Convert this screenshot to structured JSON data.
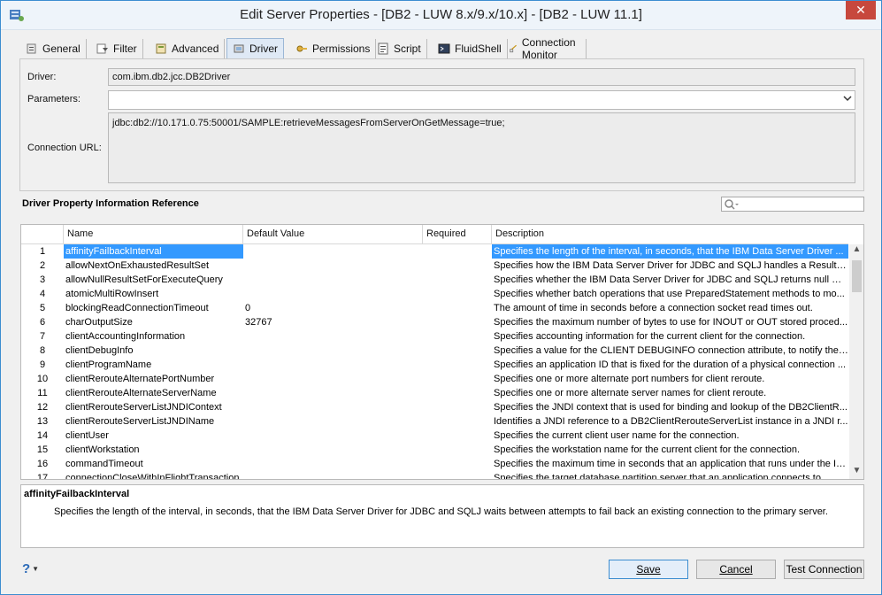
{
  "window": {
    "title": "Edit Server Properties - [DB2 - LUW 8.x/9.x/10.x] - [DB2 - LUW 11.1]",
    "close_label": "✕"
  },
  "tabs": [
    {
      "label": "General",
      "icon": "general-icon"
    },
    {
      "label": "Filter",
      "icon": "filter-icon"
    },
    {
      "label": "Advanced",
      "icon": "advanced-icon"
    },
    {
      "label": "Driver",
      "icon": "driver-icon",
      "active": true
    },
    {
      "label": "Permissions",
      "icon": "permissions-icon"
    },
    {
      "label": "Script",
      "icon": "script-icon"
    },
    {
      "label": "FluidShell",
      "icon": "fluidshell-icon"
    },
    {
      "label": "Connection Monitor",
      "icon": "connection-monitor-icon"
    }
  ],
  "driver_panel": {
    "driver_label": "Driver:",
    "driver_value": "com.ibm.db2.jcc.DB2Driver",
    "parameters_label": "Parameters:",
    "parameters_value": "",
    "url_label": "Connection URL:",
    "url_value": "jdbc:db2://10.171.0.75:50001/SAMPLE:retrieveMessagesFromServerOnGetMessage=true;"
  },
  "reference": {
    "title": "Driver Property Information Reference",
    "search_placeholder": ""
  },
  "table": {
    "columns": [
      "Name",
      "Default Value",
      "Required",
      "Description"
    ],
    "rows": [
      {
        "num": "1",
        "name": "affinityFailbackInterval",
        "default": "",
        "required": "",
        "desc": "Specifies the length of the interval, in seconds, that the IBM Data Server Driver ..."
      },
      {
        "num": "2",
        "name": "allowNextOnExhaustedResultSet",
        "default": "",
        "required": "",
        "desc": "Specifies how the IBM Data Server Driver for JDBC and SQLJ handles a ResultSe..."
      },
      {
        "num": "3",
        "name": "allowNullResultSetForExecuteQuery",
        "default": "",
        "required": "",
        "desc": "Specifies whether the IBM Data Server Driver for JDBC and SQLJ returns null wh..."
      },
      {
        "num": "4",
        "name": "atomicMultiRowInsert",
        "default": "",
        "required": "",
        "desc": "Specifies whether batch operations that use PreparedStatement methods to mo..."
      },
      {
        "num": "5",
        "name": "blockingReadConnectionTimeout",
        "default": "0",
        "required": "",
        "desc": "The amount of time in seconds before a connection socket read times out."
      },
      {
        "num": "6",
        "name": "charOutputSize",
        "default": "32767",
        "required": "",
        "desc": "Specifies the maximum number of bytes to use for INOUT or OUT stored proced..."
      },
      {
        "num": "7",
        "name": "clientAccountingInformation",
        "default": "",
        "required": "",
        "desc": "Specifies accounting information for the current client for the connection."
      },
      {
        "num": "8",
        "name": "clientDebugInfo",
        "default": "",
        "required": "",
        "desc": "Specifies a value for the CLIENT DEBUGINFO connection attribute, to notify the ..."
      },
      {
        "num": "9",
        "name": "clientProgramName",
        "default": "",
        "required": "",
        "desc": "Specifies an application ID that is fixed for the duration of a physical connection ..."
      },
      {
        "num": "10",
        "name": "clientRerouteAlternatePortNumber",
        "default": "",
        "required": "",
        "desc": "Specifies one or more alternate port numbers for client reroute."
      },
      {
        "num": "11",
        "name": "clientRerouteAlternateServerName",
        "default": "",
        "required": "",
        "desc": "Specifies one or more alternate server names for client reroute."
      },
      {
        "num": "12",
        "name": "clientRerouteServerListJNDIContext",
        "default": "",
        "required": "",
        "desc": "Specifies the JNDI context that is used for binding and lookup of the DB2ClientR..."
      },
      {
        "num": "13",
        "name": "clientRerouteServerListJNDIName",
        "default": "",
        "required": "",
        "desc": "Identifies a JNDI reference to a DB2ClientRerouteServerList instance in a JNDI r..."
      },
      {
        "num": "14",
        "name": "clientUser",
        "default": "",
        "required": "",
        "desc": "Specifies the current client user name for the connection."
      },
      {
        "num": "15",
        "name": "clientWorkstation",
        "default": "",
        "required": "",
        "desc": "Specifies the workstation name for the current client for the connection."
      },
      {
        "num": "16",
        "name": "commandTimeout",
        "default": "",
        "required": "",
        "desc": "Specifies the maximum time in seconds that an application that runs under the IB..."
      },
      {
        "num": "17",
        "name": "connectionCloseWithInFlightTransaction",
        "default": "",
        "required": "",
        "desc": "Specifies the target database partition server that an application connects to..."
      }
    ]
  },
  "description_panel": {
    "title": "affinityFailbackInterval",
    "text": "Specifies the length of the interval, in seconds, that the IBM Data Server Driver for JDBC and SQLJ waits between attempts to fail back an existing connection to the primary server."
  },
  "footer": {
    "help_label": "?",
    "save_label": "Save",
    "cancel_label": "Cancel",
    "test_label": "Test Connection"
  }
}
